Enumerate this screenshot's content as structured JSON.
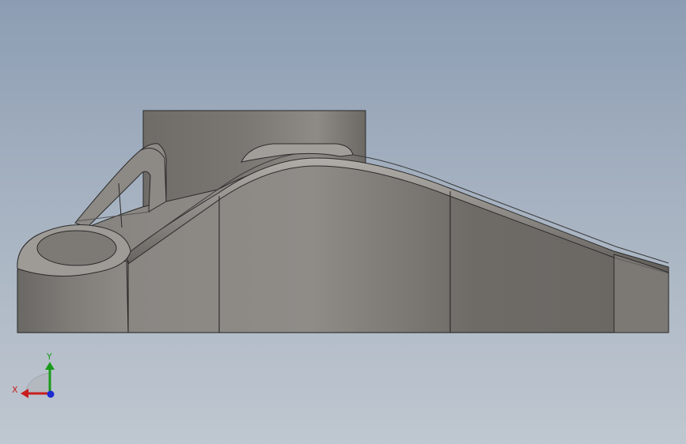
{
  "viewport": {
    "background_top": "#8c9db3",
    "background_bottom": "#bfc7d0",
    "model_color": "#8b8884"
  },
  "triad": {
    "x_label": "X",
    "y_label": "Y",
    "x_color": "#c81e1e",
    "y_color": "#1a9a1a",
    "z_color": "#1e2ad2"
  }
}
